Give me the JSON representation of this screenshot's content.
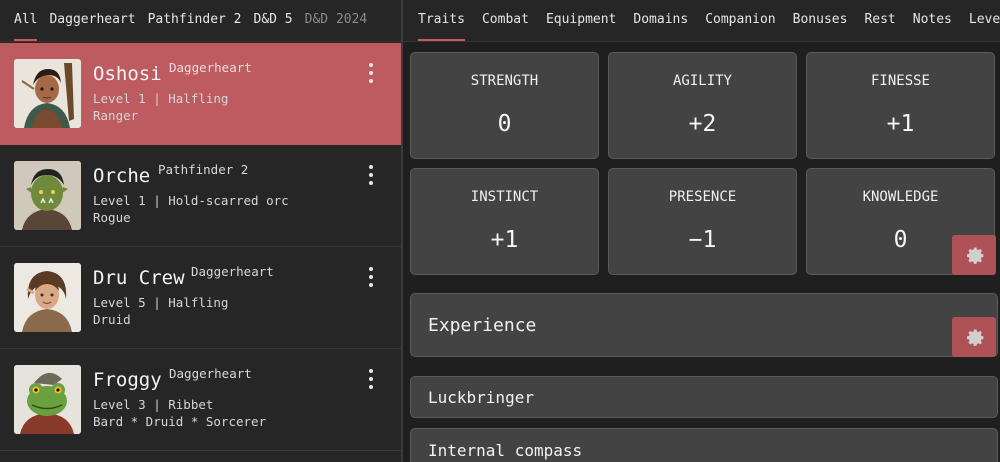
{
  "left_tabs": [
    {
      "label": "All",
      "active": true
    },
    {
      "label": "Daggerheart"
    },
    {
      "label": "Pathfinder 2"
    },
    {
      "label": "D&D 5"
    },
    {
      "label": "D&D 2024",
      "dim": true
    }
  ],
  "characters": [
    {
      "name": "Oshosi",
      "system": "Daggerheart",
      "line1": "Level 1 | Halfling",
      "line2": "Ranger",
      "selected": true
    },
    {
      "name": "Orche",
      "system": "Pathfinder 2",
      "line1": "Level 1 | Hold-scarred orc",
      "line2": "Rogue"
    },
    {
      "name": "Dru Crew",
      "system": "Daggerheart",
      "line1": "Level 5 | Halfling",
      "line2": "Druid"
    },
    {
      "name": "Froggy",
      "system": "Daggerheart",
      "line1": "Level 3 | Ribbet",
      "line2": "Bard * Druid * Sorcerer"
    }
  ],
  "right_tabs": [
    {
      "label": "Traits",
      "active": true
    },
    {
      "label": "Combat"
    },
    {
      "label": "Equipment"
    },
    {
      "label": "Domains"
    },
    {
      "label": "Companion"
    },
    {
      "label": "Bonuses"
    },
    {
      "label": "Rest"
    },
    {
      "label": "Notes"
    },
    {
      "label": "Leveling"
    }
  ],
  "traits": [
    {
      "name": "STRENGTH",
      "value": "0"
    },
    {
      "name": "AGILITY",
      "value": "+2"
    },
    {
      "name": "FINESSE",
      "value": "+1"
    },
    {
      "name": "INSTINCT",
      "value": "+1"
    },
    {
      "name": "PRESENCE",
      "value": "−1"
    },
    {
      "name": "KNOWLEDGE",
      "value": "0"
    }
  ],
  "sections": {
    "experience": "Experience",
    "items": [
      "Luckbringer",
      "Internal compass"
    ]
  },
  "colors": {
    "accent": "#c85a5f",
    "selected_row": "#bd5b61",
    "card": "#434343"
  },
  "icons": {
    "kebab": "more-vertical-icon",
    "gear": "gear-icon"
  }
}
